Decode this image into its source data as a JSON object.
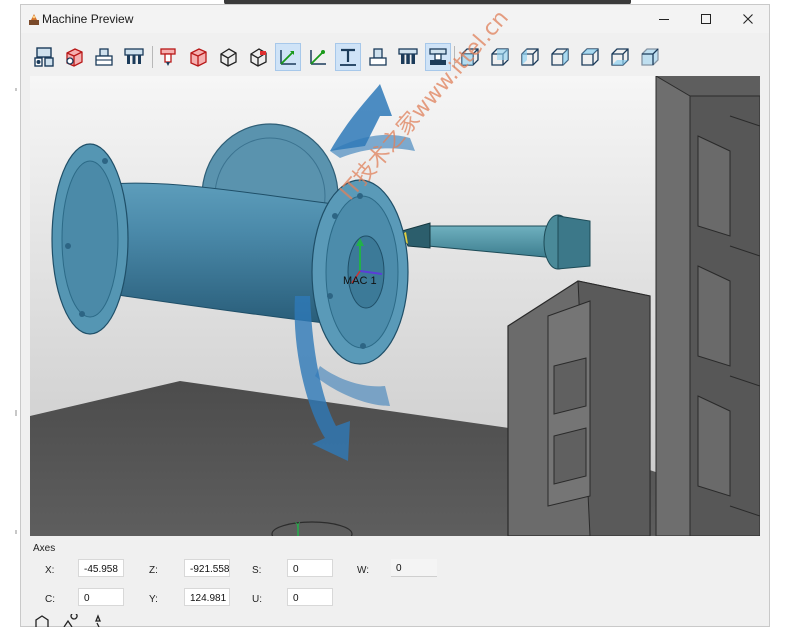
{
  "window": {
    "title": "Machine Preview",
    "controls": {
      "minimize": "minimize",
      "maximize": "maximize",
      "close": "close"
    }
  },
  "toolbar": {
    "icons": [
      "machine-components-icon",
      "workpiece-box-icon",
      "fixture-icon",
      "tool-holder-icon",
      "spindle-icon",
      "stock-box-icon",
      "part-view-icon",
      "section-box-icon",
      "axis-system-icon",
      "axis-arrow-icon",
      "tool-t-icon",
      "fixture-base-icon",
      "tooling-icon",
      "setup-icon",
      "view-front-icon",
      "view-back-icon",
      "view-left-icon",
      "view-right-icon",
      "view-top-icon",
      "view-bottom-icon",
      "view-iso-icon"
    ],
    "active_indices": [
      8,
      10,
      13
    ]
  },
  "viewport": {
    "origin_label": "MAC 1",
    "axis_label_y": "Y",
    "watermark": "IT技术之家www.ittel.cn"
  },
  "axes": {
    "title": "Axes",
    "fields": {
      "x": {
        "label": "X:",
        "value": "-45.958"
      },
      "z": {
        "label": "Z:",
        "value": "-921.558"
      },
      "s": {
        "label": "S:",
        "value": "0"
      },
      "w": {
        "label": "W:",
        "value": "0"
      },
      "c": {
        "label": "C:",
        "value": "0"
      },
      "y": {
        "label": "Y:",
        "value": "124.981"
      },
      "u": {
        "label": "U:",
        "value": "0"
      }
    }
  },
  "colors": {
    "part_blue": "#3f7f9f",
    "part_blue_light": "#6aa7c4",
    "machine_gray": "#6a6a6a",
    "arrow_blue": "#2e79b8",
    "active_button": "#cfe3f7"
  }
}
